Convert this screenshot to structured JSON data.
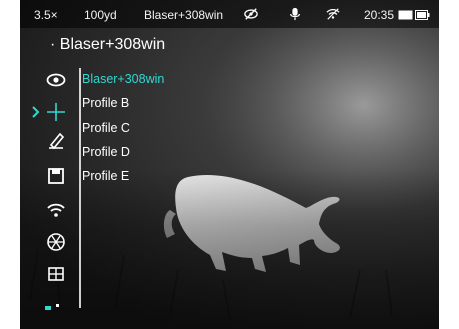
{
  "status_bar": {
    "zoom": "3.5×",
    "range": "100yd",
    "profile": "Blaser+308win",
    "time": "20:35",
    "icons": [
      "eye-crossed-icon",
      "microphone-icon",
      "wifi-off-icon",
      "battery-icon"
    ]
  },
  "profile_title": "· Blaser+308win",
  "sidebar": {
    "items": [
      {
        "icon": "eye-icon"
      },
      {
        "icon": "crosshair-icon"
      },
      {
        "icon": "pencil-icon"
      },
      {
        "icon": "save-icon"
      },
      {
        "icon": "wifi-icon"
      },
      {
        "icon": "aperture-icon"
      },
      {
        "icon": "grid-icon"
      }
    ]
  },
  "profiles": [
    {
      "label": "Blaser+308win",
      "selected": true
    },
    {
      "label": "Profile B"
    },
    {
      "label": "Profile C"
    },
    {
      "label": "Profile D"
    },
    {
      "label": "Profile E"
    }
  ],
  "colors": {
    "accent": "#31d8d1",
    "text": "#ffffff"
  }
}
